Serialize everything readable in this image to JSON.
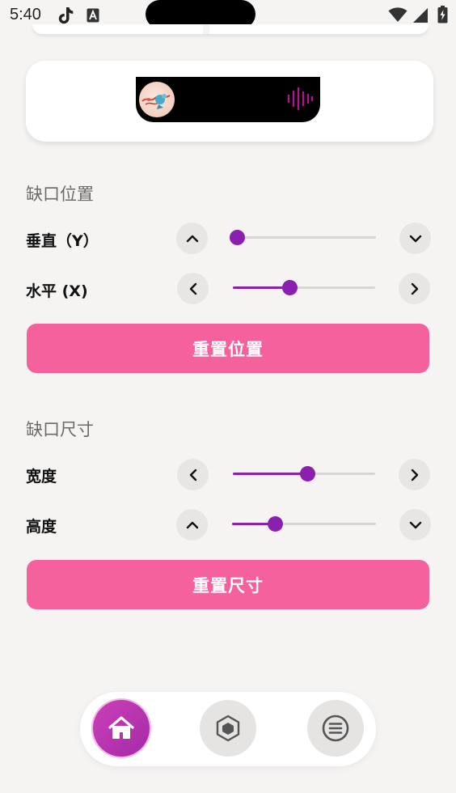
{
  "status_bar": {
    "time": "5:40",
    "icons": [
      "tiktok-icon",
      "a-icon",
      "wifi-icon",
      "signal-icon",
      "battery-icon"
    ]
  },
  "preview": {
    "album_art": "album-art",
    "waveform": "waveform-icon"
  },
  "position_section": {
    "title": "缺口位置",
    "vertical": {
      "label": "垂直（Y）",
      "value": 0.0,
      "dec_icon": "chevron-up-icon",
      "inc_icon": "chevron-down-icon"
    },
    "horizontal": {
      "label": "水平 (X)",
      "value": 0.4,
      "dec_icon": "chevron-left-icon",
      "inc_icon": "chevron-right-icon"
    },
    "reset_label": "重置位置"
  },
  "size_section": {
    "title": "缺口尺寸",
    "width": {
      "label": "宽度",
      "value": 0.52,
      "dec_icon": "chevron-left-icon",
      "inc_icon": "chevron-right-icon"
    },
    "height": {
      "label": "高度",
      "value": 0.3,
      "dec_icon": "chevron-up-icon",
      "inc_icon": "chevron-down-icon"
    },
    "reset_label": "重置尺寸"
  },
  "bottom_nav": {
    "items": [
      {
        "icon": "home-icon",
        "active": true
      },
      {
        "icon": "cube-icon",
        "active": false
      },
      {
        "icon": "menu-icon",
        "active": false
      }
    ]
  },
  "colors": {
    "accent": "#8a1fb0",
    "button": "#f5619d",
    "background": "#f6f4f3"
  }
}
